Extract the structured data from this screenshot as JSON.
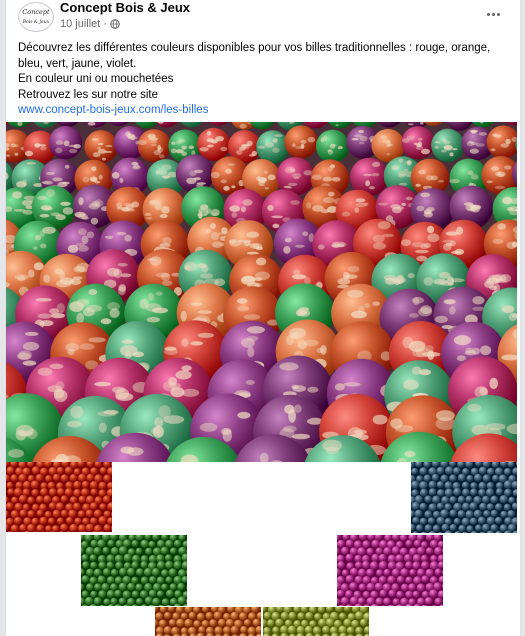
{
  "post": {
    "page_name": "Concept Bois & Jeux",
    "avatar_text_top": "Concept",
    "avatar_text_bottom": "Bois & Jeux",
    "date": "10 juillet",
    "separator": "·",
    "privacy_icon": "globe-icon",
    "more_icon": "more-options-icon",
    "text_lines": [
      "Découvrez les différentes couleurs disponibles pour vos billes traditionnelles : rouge, orange, bleu, vert, jaune, violet.",
      "En couleur uni ou mouchetées",
      "Retrouvez les sur notre site"
    ],
    "link": "www.concept-bois-jeux.com/les-billes"
  },
  "media": {
    "main_photo": "speckled-marbles-photo",
    "thumbnails": [
      {
        "name": "red-marbles",
        "color": "#c8401e"
      },
      {
        "name": "blue-marbles",
        "color": "#4e6a80"
      },
      {
        "name": "green-marbles",
        "color": "#4a8a3e"
      },
      {
        "name": "violet-marbles",
        "color": "#b63f94"
      },
      {
        "name": "orange-marbles",
        "color": "#c27035"
      },
      {
        "name": "yellow-marbles",
        "color": "#9aa44a"
      }
    ]
  },
  "colors": {
    "link": "#216fdb",
    "secondary_text": "#65676b"
  }
}
